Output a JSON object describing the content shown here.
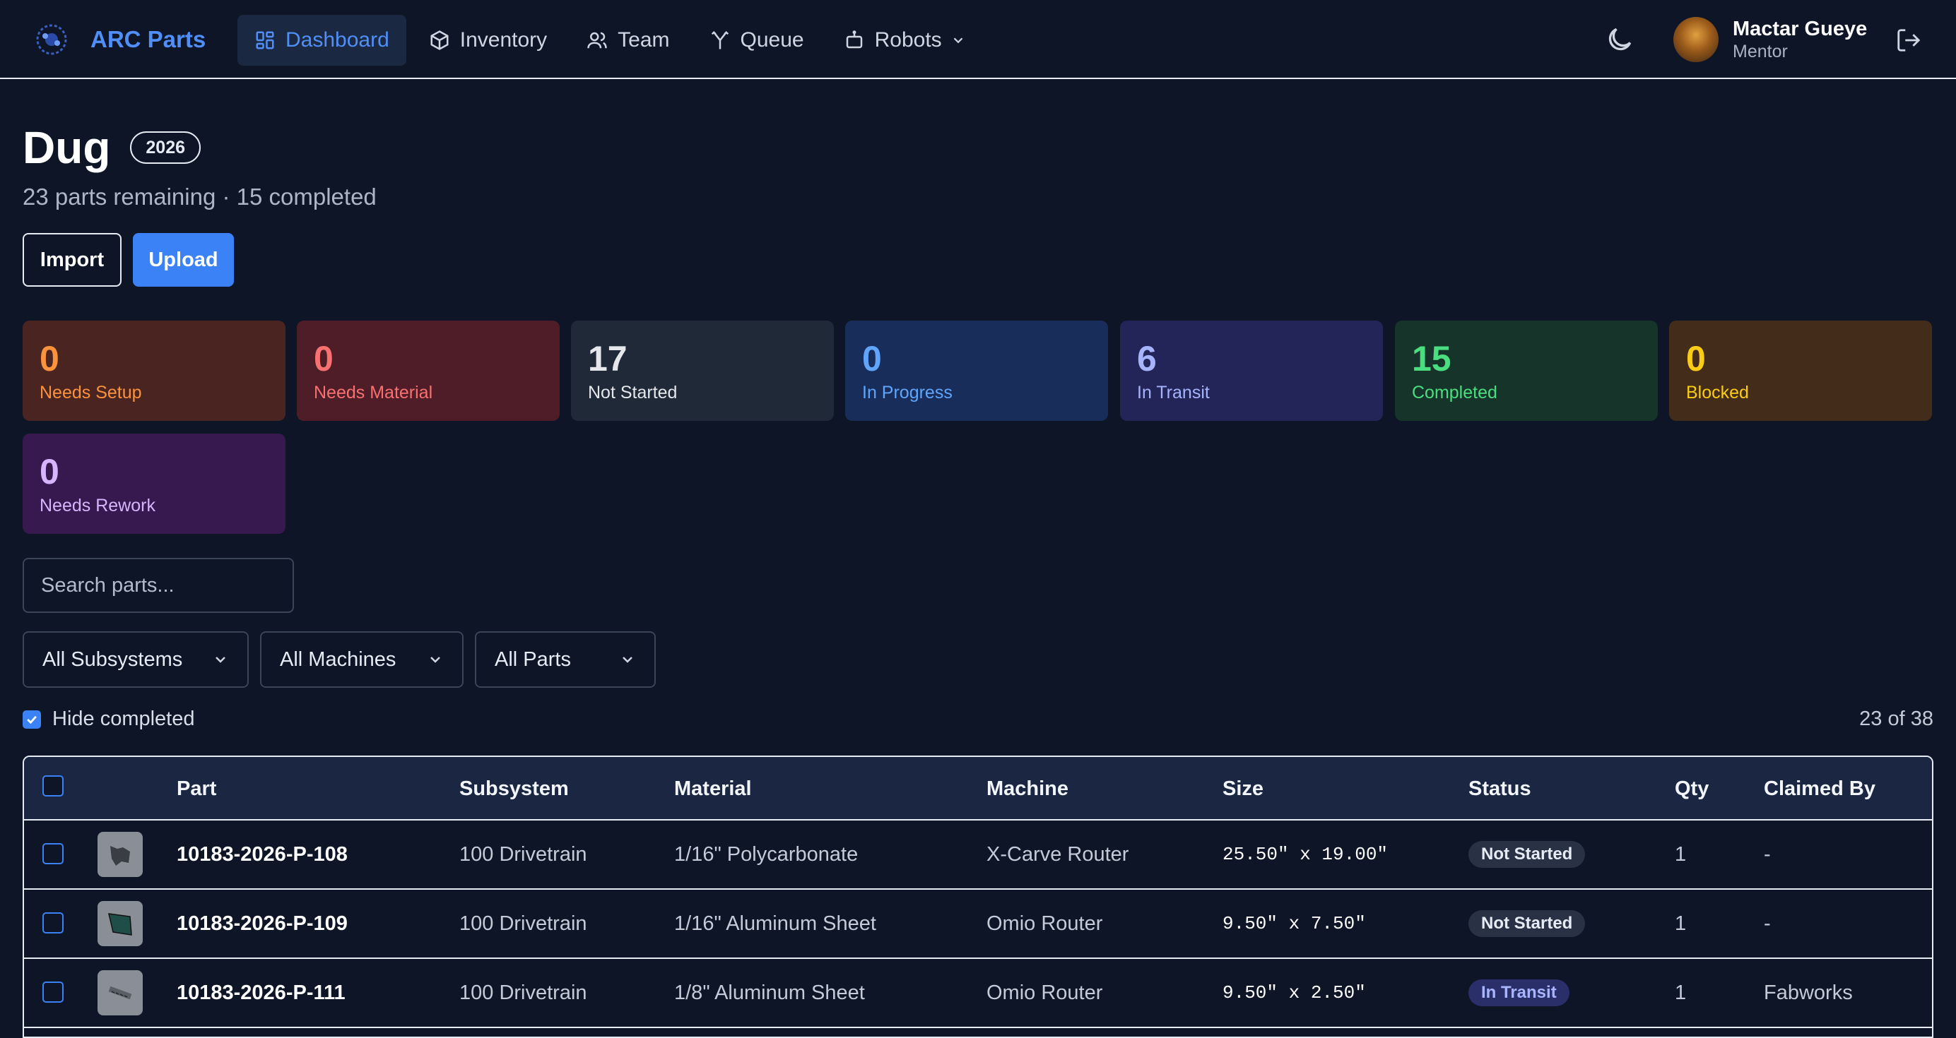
{
  "header": {
    "brand": "ARC Parts",
    "nav": [
      {
        "label": "Dashboard",
        "icon": "dashboard-icon",
        "active": true
      },
      {
        "label": "Inventory",
        "icon": "box-icon"
      },
      {
        "label": "Team",
        "icon": "users-icon"
      },
      {
        "label": "Queue",
        "icon": "queue-icon"
      },
      {
        "label": "Robots",
        "icon": "robot-icon"
      }
    ],
    "user": {
      "name": "Mactar Gueye",
      "role": "Mentor"
    }
  },
  "page": {
    "title": "Dug",
    "year": "2026",
    "subtitle": "23 parts remaining · 15 completed",
    "import_label": "Import",
    "upload_label": "Upload"
  },
  "stats": [
    {
      "value": "0",
      "label": "Needs Setup",
      "bg": "#4a2421",
      "fg": "#fb923c"
    },
    {
      "value": "0",
      "label": "Needs Material",
      "bg": "#4e1d27",
      "fg": "#f87171"
    },
    {
      "value": "17",
      "label": "Not Started",
      "bg": "#1f2937",
      "fg": "#e5e7eb"
    },
    {
      "value": "0",
      "label": "In Progress",
      "bg": "#192d5a",
      "fg": "#60a5fa"
    },
    {
      "value": "6",
      "label": "In Transit",
      "bg": "#232457",
      "fg": "#a5b4fc"
    },
    {
      "value": "15",
      "label": "Completed",
      "bg": "#163429",
      "fg": "#4ade80"
    },
    {
      "value": "0",
      "label": "Blocked",
      "bg": "#432c1a",
      "fg": "#facc15"
    },
    {
      "value": "0",
      "label": "Needs Rework",
      "bg": "#37184f",
      "fg": "#d8b4fe"
    }
  ],
  "filters": {
    "search_placeholder": "Search parts...",
    "subsystem": "All Subsystems",
    "machine": "All Machines",
    "parts": "All Parts",
    "hide_completed_label": "Hide completed",
    "hide_completed": true,
    "count": "23 of 38"
  },
  "table": {
    "columns": [
      "Part",
      "Subsystem",
      "Material",
      "Machine",
      "Size",
      "Status",
      "Qty",
      "Claimed By"
    ],
    "rows": [
      {
        "part": "10183-2026-P-108",
        "subsystem": "100 Drivetrain",
        "material": "1/16\" Polycarbonate",
        "machine": "X-Carve Router",
        "size": "25.50\" x 19.00\"",
        "status": "Not Started",
        "qty": "1",
        "claimed_by": "-"
      },
      {
        "part": "10183-2026-P-109",
        "subsystem": "100 Drivetrain",
        "material": "1/16\" Aluminum Sheet",
        "machine": "Omio Router",
        "size": "9.50\" x 7.50\"",
        "status": "Not Started",
        "qty": "1",
        "claimed_by": "-"
      },
      {
        "part": "10183-2026-P-111",
        "subsystem": "100 Drivetrain",
        "material": "1/8\" Aluminum Sheet",
        "machine": "Omio Router",
        "size": "9.50\" x 2.50\"",
        "status": "In Transit",
        "qty": "1",
        "claimed_by": "Fabworks"
      }
    ]
  }
}
